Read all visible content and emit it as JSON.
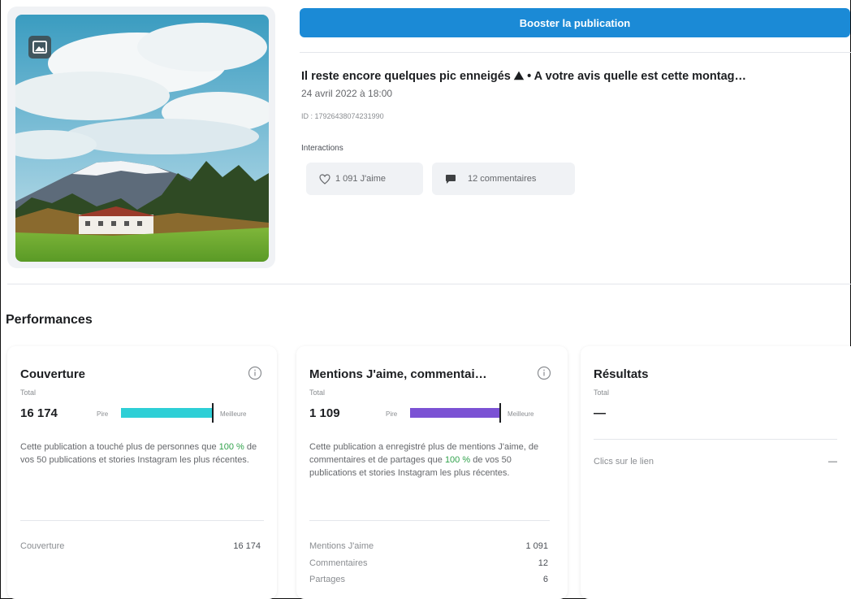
{
  "post": {
    "boost_label": "Booster la publication",
    "title": "Il reste encore quelques pic enneigés ⛰ • A votre avis quelle est cette montag…",
    "date": "24 avril 2022 à 18:00",
    "id_text": "ID : 17926438074231990",
    "interactions_label": "Interactions",
    "likes_label": "1 091 J'aime",
    "comments_label": "12 commentaires"
  },
  "performances": {
    "title": "Performances",
    "cards": [
      {
        "title": "Couverture",
        "total_label": "Total",
        "total_value": "16 174",
        "bar_min_label": "Pire",
        "bar_max_label": "Meilleure",
        "bar_fraction": 1.0,
        "bar_color": "#2ecfd6",
        "desc_before": "Cette publication a touché plus de personnes que ",
        "desc_pct": "100 %",
        "desc_after": " de vos 50 publications et stories Instagram les plus récentes.",
        "rows": [
          {
            "label": "Couverture",
            "value": "16 174"
          }
        ]
      },
      {
        "title": "Mentions J'aime, commentai…",
        "total_label": "Total",
        "total_value": "1 109",
        "bar_min_label": "Pire",
        "bar_max_label": "Meilleure",
        "bar_fraction": 1.0,
        "bar_color": "#7b52d4",
        "desc_before": "Cette publication a enregistré plus de mentions J'aime, de commentaires et de partages que ",
        "desc_pct": "100 %",
        "desc_after": " de vos 50 publications et stories Instagram les plus récentes.",
        "rows": [
          {
            "label": "Mentions J'aime",
            "value": "1 091"
          },
          {
            "label": "Commentaires",
            "value": "12"
          },
          {
            "label": "Partages",
            "value": "6"
          }
        ]
      },
      {
        "title": "Résultats",
        "total_label": "Total",
        "total_value": "—",
        "rows": [
          {
            "label": "Clics sur le lien",
            "value": "—"
          }
        ]
      }
    ]
  },
  "colors": {
    "accent_blue": "#1b8ad6",
    "positive_green": "#31a24c"
  },
  "icons": {
    "media_type": "image-icon",
    "likes": "heart-outline-icon",
    "comments": "speech-bubble-icon",
    "info": "info-circle-icon"
  }
}
